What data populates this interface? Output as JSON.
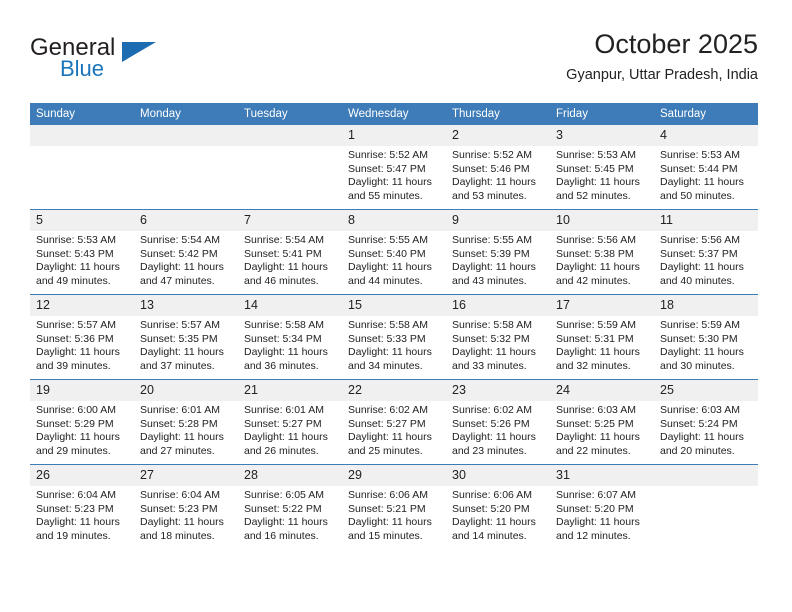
{
  "brand": {
    "name_top": "General",
    "name_bottom": "Blue",
    "triangle_color": "#1b6cb0",
    "blue_color": "#1b75bb"
  },
  "header": {
    "title": "October 2025",
    "subtitle": "Gyanpur, Uttar Pradesh, India"
  },
  "theme": {
    "header_blue": "#3d7cb8",
    "daynum_band": "#f0f0f0",
    "text": "#222222"
  },
  "calendar": {
    "weekdays": [
      "Sunday",
      "Monday",
      "Tuesday",
      "Wednesday",
      "Thursday",
      "Friday",
      "Saturday"
    ],
    "weeks": [
      [
        {
          "day": "",
          "lines": []
        },
        {
          "day": "",
          "lines": []
        },
        {
          "day": "",
          "lines": []
        },
        {
          "day": "1",
          "lines": [
            "Sunrise: 5:52 AM",
            "Sunset: 5:47 PM",
            "Daylight: 11 hours and 55 minutes."
          ]
        },
        {
          "day": "2",
          "lines": [
            "Sunrise: 5:52 AM",
            "Sunset: 5:46 PM",
            "Daylight: 11 hours and 53 minutes."
          ]
        },
        {
          "day": "3",
          "lines": [
            "Sunrise: 5:53 AM",
            "Sunset: 5:45 PM",
            "Daylight: 11 hours and 52 minutes."
          ]
        },
        {
          "day": "4",
          "lines": [
            "Sunrise: 5:53 AM",
            "Sunset: 5:44 PM",
            "Daylight: 11 hours and 50 minutes."
          ]
        }
      ],
      [
        {
          "day": "5",
          "lines": [
            "Sunrise: 5:53 AM",
            "Sunset: 5:43 PM",
            "Daylight: 11 hours and 49 minutes."
          ]
        },
        {
          "day": "6",
          "lines": [
            "Sunrise: 5:54 AM",
            "Sunset: 5:42 PM",
            "Daylight: 11 hours and 47 minutes."
          ]
        },
        {
          "day": "7",
          "lines": [
            "Sunrise: 5:54 AM",
            "Sunset: 5:41 PM",
            "Daylight: 11 hours and 46 minutes."
          ]
        },
        {
          "day": "8",
          "lines": [
            "Sunrise: 5:55 AM",
            "Sunset: 5:40 PM",
            "Daylight: 11 hours and 44 minutes."
          ]
        },
        {
          "day": "9",
          "lines": [
            "Sunrise: 5:55 AM",
            "Sunset: 5:39 PM",
            "Daylight: 11 hours and 43 minutes."
          ]
        },
        {
          "day": "10",
          "lines": [
            "Sunrise: 5:56 AM",
            "Sunset: 5:38 PM",
            "Daylight: 11 hours and 42 minutes."
          ]
        },
        {
          "day": "11",
          "lines": [
            "Sunrise: 5:56 AM",
            "Sunset: 5:37 PM",
            "Daylight: 11 hours and 40 minutes."
          ]
        }
      ],
      [
        {
          "day": "12",
          "lines": [
            "Sunrise: 5:57 AM",
            "Sunset: 5:36 PM",
            "Daylight: 11 hours and 39 minutes."
          ]
        },
        {
          "day": "13",
          "lines": [
            "Sunrise: 5:57 AM",
            "Sunset: 5:35 PM",
            "Daylight: 11 hours and 37 minutes."
          ]
        },
        {
          "day": "14",
          "lines": [
            "Sunrise: 5:58 AM",
            "Sunset: 5:34 PM",
            "Daylight: 11 hours and 36 minutes."
          ]
        },
        {
          "day": "15",
          "lines": [
            "Sunrise: 5:58 AM",
            "Sunset: 5:33 PM",
            "Daylight: 11 hours and 34 minutes."
          ]
        },
        {
          "day": "16",
          "lines": [
            "Sunrise: 5:58 AM",
            "Sunset: 5:32 PM",
            "Daylight: 11 hours and 33 minutes."
          ]
        },
        {
          "day": "17",
          "lines": [
            "Sunrise: 5:59 AM",
            "Sunset: 5:31 PM",
            "Daylight: 11 hours and 32 minutes."
          ]
        },
        {
          "day": "18",
          "lines": [
            "Sunrise: 5:59 AM",
            "Sunset: 5:30 PM",
            "Daylight: 11 hours and 30 minutes."
          ]
        }
      ],
      [
        {
          "day": "19",
          "lines": [
            "Sunrise: 6:00 AM",
            "Sunset: 5:29 PM",
            "Daylight: 11 hours and 29 minutes."
          ]
        },
        {
          "day": "20",
          "lines": [
            "Sunrise: 6:01 AM",
            "Sunset: 5:28 PM",
            "Daylight: 11 hours and 27 minutes."
          ]
        },
        {
          "day": "21",
          "lines": [
            "Sunrise: 6:01 AM",
            "Sunset: 5:27 PM",
            "Daylight: 11 hours and 26 minutes."
          ]
        },
        {
          "day": "22",
          "lines": [
            "Sunrise: 6:02 AM",
            "Sunset: 5:27 PM",
            "Daylight: 11 hours and 25 minutes."
          ]
        },
        {
          "day": "23",
          "lines": [
            "Sunrise: 6:02 AM",
            "Sunset: 5:26 PM",
            "Daylight: 11 hours and 23 minutes."
          ]
        },
        {
          "day": "24",
          "lines": [
            "Sunrise: 6:03 AM",
            "Sunset: 5:25 PM",
            "Daylight: 11 hours and 22 minutes."
          ]
        },
        {
          "day": "25",
          "lines": [
            "Sunrise: 6:03 AM",
            "Sunset: 5:24 PM",
            "Daylight: 11 hours and 20 minutes."
          ]
        }
      ],
      [
        {
          "day": "26",
          "lines": [
            "Sunrise: 6:04 AM",
            "Sunset: 5:23 PM",
            "Daylight: 11 hours and 19 minutes."
          ]
        },
        {
          "day": "27",
          "lines": [
            "Sunrise: 6:04 AM",
            "Sunset: 5:23 PM",
            "Daylight: 11 hours and 18 minutes."
          ]
        },
        {
          "day": "28",
          "lines": [
            "Sunrise: 6:05 AM",
            "Sunset: 5:22 PM",
            "Daylight: 11 hours and 16 minutes."
          ]
        },
        {
          "day": "29",
          "lines": [
            "Sunrise: 6:06 AM",
            "Sunset: 5:21 PM",
            "Daylight: 11 hours and 15 minutes."
          ]
        },
        {
          "day": "30",
          "lines": [
            "Sunrise: 6:06 AM",
            "Sunset: 5:20 PM",
            "Daylight: 11 hours and 14 minutes."
          ]
        },
        {
          "day": "31",
          "lines": [
            "Sunrise: 6:07 AM",
            "Sunset: 5:20 PM",
            "Daylight: 11 hours and 12 minutes."
          ]
        },
        {
          "day": "",
          "lines": []
        }
      ]
    ]
  }
}
